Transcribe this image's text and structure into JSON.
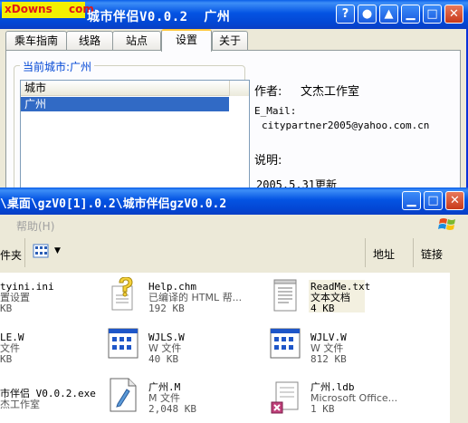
{
  "back_window": {
    "watermark": {
      "left": "xDowns",
      "right": "com"
    },
    "title": "城市伴侣V0.0.2  广州",
    "tabs": [
      "乘车指南",
      "线路",
      "站点",
      "设置",
      "关于"
    ],
    "active_tab": "设置",
    "group_label": "当前城市:广州",
    "list": {
      "header": "城市",
      "selected_item": "广州"
    },
    "about": {
      "author_label": "作者:",
      "author_value": "文杰工作室",
      "email_label": "E_Mail:",
      "email_value": "citypartner2005@yahoo.com.cn",
      "note_label": "说明:",
      "note_value": "2005.5.31更新"
    }
  },
  "front_window": {
    "title": "\\桌面\\gzV0[1].0.2\\城市伴侣gzV0.0.2",
    "menu": [
      "帮助(H)"
    ],
    "toolbar": {
      "folder_label": "件夹",
      "address_label": "地址",
      "links_label": "链接"
    },
    "files": [
      {
        "name": "tyini.ini",
        "desc": "置设置",
        "size": "KB"
      },
      {
        "name": "Help.chm",
        "desc": "已编译的 HTML 帮...",
        "size": "192 KB"
      },
      {
        "name": "ReadMe.txt",
        "desc": "文本文档",
        "size": "4 KB"
      },
      {
        "name": "LE.W",
        "desc": "文件",
        "size": "KB"
      },
      {
        "name": "WJLS.W",
        "desc": "W 文件",
        "size": "40 KB"
      },
      {
        "name": "WJLV.W",
        "desc": "W 文件",
        "size": "812 KB"
      },
      {
        "name": "市伴侣 V0.0.2.exe",
        "desc": "杰工作室",
        "size": ""
      },
      {
        "name": "广州.M",
        "desc": "M 文件",
        "size": "2,048 KB"
      },
      {
        "name": "广州.ldb",
        "desc": "Microsoft Office...",
        "size": "1 KB"
      }
    ]
  },
  "colors": {
    "titlebar": "#0454e3",
    "selection": "#316ac5",
    "watermark_bg": "#f4f000"
  }
}
